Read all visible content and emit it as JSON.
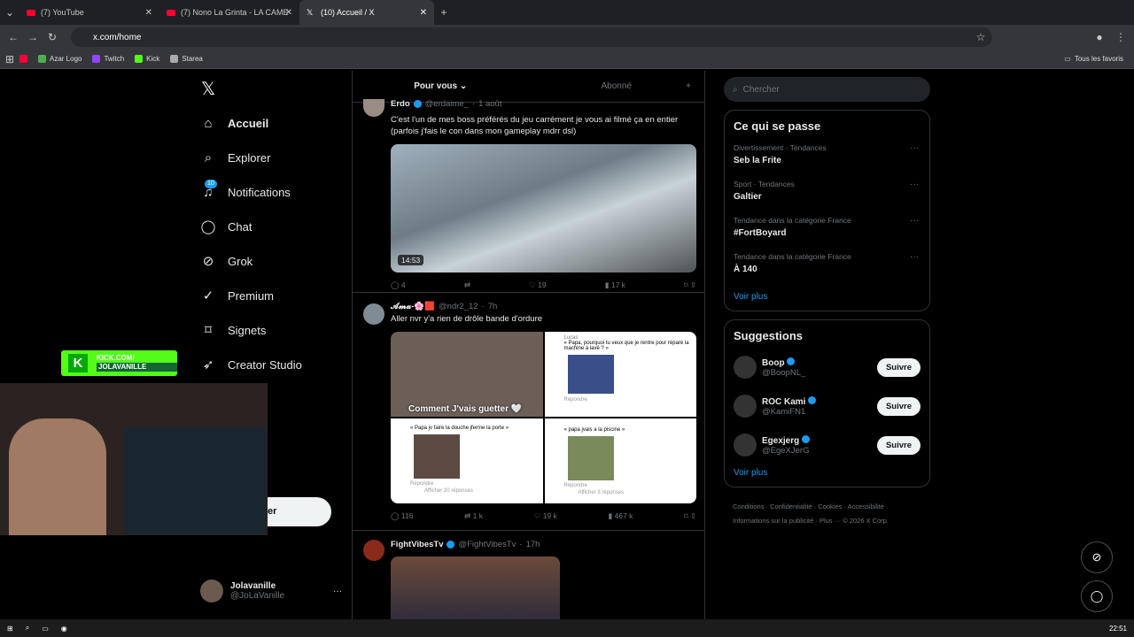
{
  "browser": {
    "tabs": [
      {
        "title": "(7) YouTube"
      },
      {
        "title": "(7) Nono La Grinta - LA CAME"
      },
      {
        "title": "(10) Accueil / X"
      }
    ],
    "url": "x.com/home",
    "bookmarks": [
      {
        "label": "Azar Logo",
        "color": "#4caf50"
      },
      {
        "label": "Twitch",
        "color": "#9146ff"
      },
      {
        "label": "Kick",
        "color": "#53fc18"
      },
      {
        "label": "Starea",
        "color": "#aaaaaa"
      }
    ],
    "all_bookmarks": "Tous les favoris"
  },
  "nav": {
    "items": [
      {
        "label": "Accueil",
        "icon": "home-icon",
        "glyph": "⌂"
      },
      {
        "label": "Explorer",
        "icon": "search-icon",
        "glyph": "⌕"
      },
      {
        "label": "Notifications",
        "icon": "bell-icon",
        "glyph": "🔔︎",
        "badge": "10"
      },
      {
        "label": "Chat",
        "icon": "chat-icon",
        "glyph": "◯"
      },
      {
        "label": "Grok",
        "icon": "grok-icon",
        "glyph": "⊘"
      },
      {
        "label": "Premium",
        "icon": "premium-icon",
        "glyph": "✓"
      },
      {
        "label": "Signets",
        "icon": "bookmark-icon",
        "glyph": "⌑"
      },
      {
        "label": "Creator Studio",
        "icon": "rocket-icon",
        "glyph": "➶"
      }
    ],
    "post_button_fragment": "er",
    "profile": {
      "name": "Jolavanille",
      "handle": "@JoLaVanille"
    }
  },
  "timeline": {
    "tabs": [
      "Pour vous",
      "Abonné"
    ],
    "posts": [
      {
        "author": "Erdo",
        "handle": "@erdaime_",
        "time": "1 août",
        "text": "C'est l'un de mes boss préférés du jeu carrément je vous ai filmé ça en entier (parfois j'fais le con dans mon gameplay mdrr dsl)",
        "video_duration": "14:53",
        "replies": "4",
        "reposts": "",
        "likes": "19",
        "views": "17 k"
      },
      {
        "author": "𝓐𝓶𝓪-🌸🟥",
        "handle": "@ndr2_12",
        "time": "7h",
        "text": "Aller nvr y'a rien de drôle bande d'ordure",
        "images": [
          {
            "caption": "Comment J'vais guetter 🤍"
          },
          {
            "quote": "« Papa, pourquoi tu veux que je rentre pour réparé la machine à lavé ? »",
            "user": "Lucas",
            "reply": "Répondre"
          },
          {
            "quote": "« Papa jv faire la douche jferme la porte »",
            "reply": "Répondre",
            "more": "Afficher 20 réponses"
          },
          {
            "quote": "« papa jvais a la piscine »",
            "reply": "Répondre",
            "more": "Afficher 3 réponses"
          }
        ],
        "replies": "116",
        "reposts": "1 k",
        "likes": "19 k",
        "views": "467 k"
      },
      {
        "author": "FightVibesTv",
        "handle": "@FightVibesTv",
        "time": "17h"
      }
    ]
  },
  "sidebar": {
    "search_placeholder": "Chercher",
    "trends_title": "Ce qui se passe",
    "trends": [
      {
        "category": "Divertissement · Tendances",
        "title": "Seb la Frite"
      },
      {
        "category": "Sport · Tendances",
        "title": "Galtier"
      },
      {
        "category": "Tendance dans la catégorie France",
        "title": "#FortBoyard"
      },
      {
        "category": "Tendance dans la catégorie France",
        "title": "À 140"
      }
    ],
    "see_more": "Voir plus",
    "suggestions_title": "Suggestions",
    "suggestions": [
      {
        "name": "Boop",
        "handle": "@BoopNL_"
      },
      {
        "name": "ROC Kami",
        "handle": "@KamiFN1"
      },
      {
        "name": "Egexjerg",
        "handle": "@EgeXJerG"
      }
    ],
    "follow_label": "Suivre",
    "footer_line1": "Conditions · Confidentialité · Cookies · Accessibilité ·",
    "footer_line2": "Informations sur la publicité · Plus ··· © 2026 X Corp."
  },
  "overlay": {
    "kick_domain": "KICK.COM/",
    "kick_user": "JOLAVANILLE"
  },
  "taskbar": {
    "time": "22:51"
  }
}
